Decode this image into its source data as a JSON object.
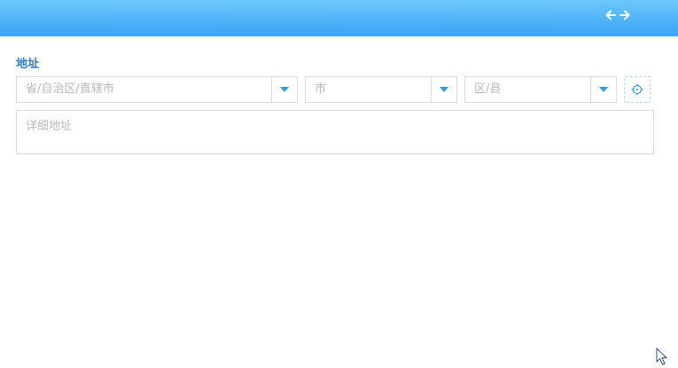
{
  "form": {
    "address_label": "地址",
    "province_placeholder": "省/自治区/直辖市",
    "city_placeholder": "市",
    "district_placeholder": "区/县",
    "detail_placeholder": "详细地址"
  },
  "icons": {
    "header_back": "arrow-left-icon",
    "header_forward": "arrow-right-icon",
    "dropdown": "caret-down-icon",
    "locate": "crosshair-icon",
    "cursor": "mouse-pointer-icon"
  },
  "colors": {
    "header_top": "#6cc8fb",
    "header_bottom": "#3aa3f5",
    "label": "#2e7fc2",
    "accent": "#2f9be8",
    "border": "#dcdcdc",
    "placeholder": "#b8b8b8"
  }
}
